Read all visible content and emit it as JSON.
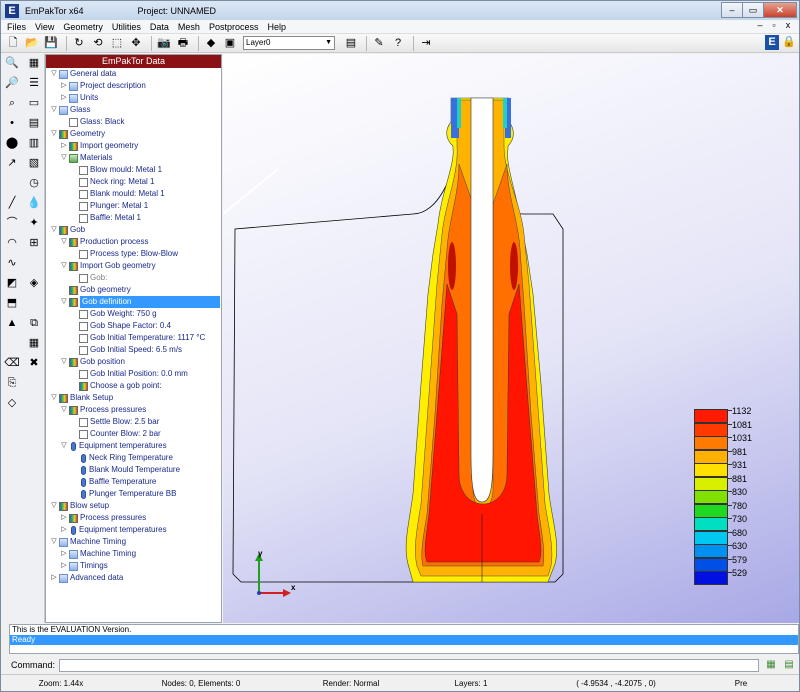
{
  "window": {
    "app_title": "EmPakTor x64",
    "project_title": "Project: UNNAMED",
    "minimize": "–",
    "maximize": "▭",
    "close": "✕"
  },
  "menu": [
    "Files",
    "View",
    "Geometry",
    "Utilities",
    "Data",
    "Mesh",
    "Postprocess",
    "Help"
  ],
  "mdi_controls": [
    "–",
    "▫",
    "x"
  ],
  "toolbar": {
    "layer_value": "Layer0"
  },
  "tree": {
    "header": "EmPakTor Data",
    "rows": [
      {
        "label": "General data",
        "indent": 0,
        "exp": "▽",
        "icon": "blue",
        "state": "normal"
      },
      {
        "label": "Project description",
        "indent": 1,
        "exp": "▷",
        "icon": "blue",
        "state": "normal"
      },
      {
        "label": "Units",
        "indent": 1,
        "exp": "▷",
        "icon": "blue",
        "state": "normal"
      },
      {
        "label": "Glass",
        "indent": 0,
        "exp": "▽",
        "icon": "blue",
        "state": "normal"
      },
      {
        "label": "Glass: Black",
        "indent": 1,
        "exp": "",
        "icon": "doc",
        "state": "normal"
      },
      {
        "label": "Geometry",
        "indent": 0,
        "exp": "▽",
        "icon": "grad",
        "state": "normal"
      },
      {
        "label": "Import geometry",
        "indent": 1,
        "exp": "▷",
        "icon": "grad",
        "state": "normal"
      },
      {
        "label": "Materials",
        "indent": 1,
        "exp": "▽",
        "icon": "green",
        "state": "normal"
      },
      {
        "label": "Blow mould: Metal 1",
        "indent": 2,
        "exp": "",
        "icon": "doc",
        "state": "normal"
      },
      {
        "label": "Neck ring: Metal 1",
        "indent": 2,
        "exp": "",
        "icon": "doc",
        "state": "normal"
      },
      {
        "label": "Blank mould: Metal 1",
        "indent": 2,
        "exp": "",
        "icon": "doc",
        "state": "normal"
      },
      {
        "label": "Plunger: Metal 1",
        "indent": 2,
        "exp": "",
        "icon": "doc",
        "state": "normal"
      },
      {
        "label": "Baffle: Metal 1",
        "indent": 2,
        "exp": "",
        "icon": "doc",
        "state": "normal"
      },
      {
        "label": "Gob",
        "indent": 0,
        "exp": "▽",
        "icon": "grad",
        "state": "normal"
      },
      {
        "label": "Production process",
        "indent": 1,
        "exp": "▽",
        "icon": "grad",
        "state": "normal"
      },
      {
        "label": "Process type: Blow-Blow",
        "indent": 2,
        "exp": "",
        "icon": "doc",
        "state": "normal"
      },
      {
        "label": "Import Gob geometry",
        "indent": 1,
        "exp": "▽",
        "icon": "grad",
        "state": "normal"
      },
      {
        "label": "Gob:",
        "indent": 2,
        "exp": "",
        "icon": "doc",
        "state": "disabled"
      },
      {
        "label": "Gob geometry",
        "indent": 1,
        "exp": "",
        "icon": "grad",
        "state": "normal"
      },
      {
        "label": "Gob definition",
        "indent": 1,
        "exp": "▽",
        "icon": "grad",
        "state": "selected"
      },
      {
        "label": "Gob Weight: 750 g",
        "indent": 2,
        "exp": "",
        "icon": "doc",
        "state": "normal"
      },
      {
        "label": "Gob Shape Factor: 0.4",
        "indent": 2,
        "exp": "",
        "icon": "doc",
        "state": "normal"
      },
      {
        "label": "Gob Initial Temperature: 1117 °C",
        "indent": 2,
        "exp": "",
        "icon": "doc",
        "state": "normal"
      },
      {
        "label": "Gob Initial Speed: 6.5 m/s",
        "indent": 2,
        "exp": "",
        "icon": "doc",
        "state": "normal"
      },
      {
        "label": "Gob position",
        "indent": 1,
        "exp": "▽",
        "icon": "grad",
        "state": "normal"
      },
      {
        "label": "Gob Initial Position: 0.0 mm",
        "indent": 2,
        "exp": "",
        "icon": "doc",
        "state": "normal"
      },
      {
        "label": "Choose a gob point:",
        "indent": 2,
        "exp": "",
        "icon": "grad",
        "state": "normal"
      },
      {
        "label": "Blank Setup",
        "indent": 0,
        "exp": "▽",
        "icon": "grad",
        "state": "normal"
      },
      {
        "label": "Process pressures",
        "indent": 1,
        "exp": "▽",
        "icon": "grad",
        "state": "normal"
      },
      {
        "label": "Settle Blow: 2.5 bar",
        "indent": 2,
        "exp": "",
        "icon": "doc",
        "state": "normal"
      },
      {
        "label": "Counter Blow: 2 bar",
        "indent": 2,
        "exp": "",
        "icon": "doc",
        "state": "normal"
      },
      {
        "label": "Equipment temperatures",
        "indent": 1,
        "exp": "▽",
        "icon": "therm",
        "state": "normal"
      },
      {
        "label": "Neck Ring Temperature",
        "indent": 2,
        "exp": "",
        "icon": "therm",
        "state": "normal"
      },
      {
        "label": "Blank Mould Temperature",
        "indent": 2,
        "exp": "",
        "icon": "therm",
        "state": "normal"
      },
      {
        "label": "Baffle Temperature",
        "indent": 2,
        "exp": "",
        "icon": "therm",
        "state": "normal"
      },
      {
        "label": "Plunger Temperature BB",
        "indent": 2,
        "exp": "",
        "icon": "therm",
        "state": "normal"
      },
      {
        "label": "Blow setup",
        "indent": 0,
        "exp": "▽",
        "icon": "grad",
        "state": "normal"
      },
      {
        "label": "Process pressures",
        "indent": 1,
        "exp": "▷",
        "icon": "grad",
        "state": "normal"
      },
      {
        "label": "Equipment temperatures",
        "indent": 1,
        "exp": "▷",
        "icon": "therm",
        "state": "normal"
      },
      {
        "label": "Machine Timing",
        "indent": 0,
        "exp": "▽",
        "icon": "blue",
        "state": "normal"
      },
      {
        "label": "Machine Timing",
        "indent": 1,
        "exp": "▷",
        "icon": "blue",
        "state": "normal"
      },
      {
        "label": "Timings",
        "indent": 1,
        "exp": "▷",
        "icon": "blue",
        "state": "normal"
      },
      {
        "label": "Advanced data",
        "indent": 0,
        "exp": "▷",
        "icon": "blue",
        "state": "normal"
      }
    ]
  },
  "legend": {
    "values": [
      "1132",
      "1081",
      "1031",
      "981",
      "931",
      "881",
      "830",
      "780",
      "730",
      "680",
      "630",
      "579",
      "529"
    ],
    "colors": [
      "#ff1a00",
      "#ff3a00",
      "#ff7a00",
      "#ffb000",
      "#ffe000",
      "#d8f000",
      "#80e000",
      "#20d820",
      "#00e0c0",
      "#00c8f0",
      "#0090f0",
      "#0050e8",
      "#0010e0"
    ]
  },
  "axis": {
    "y": "y",
    "x": "x"
  },
  "messages": {
    "line1": "This is the EVALUATION Version.",
    "line2": "Ready"
  },
  "command": {
    "label": "Command:"
  },
  "status": {
    "zoom": "Zoom: 1.44x",
    "nodes": "Nodes: 0, Elements: 0",
    "render": "Render: Normal",
    "layers": "Layers: 1",
    "coords": "( -4.9534 , -4.2075 , 0)",
    "mode": "Pre"
  }
}
